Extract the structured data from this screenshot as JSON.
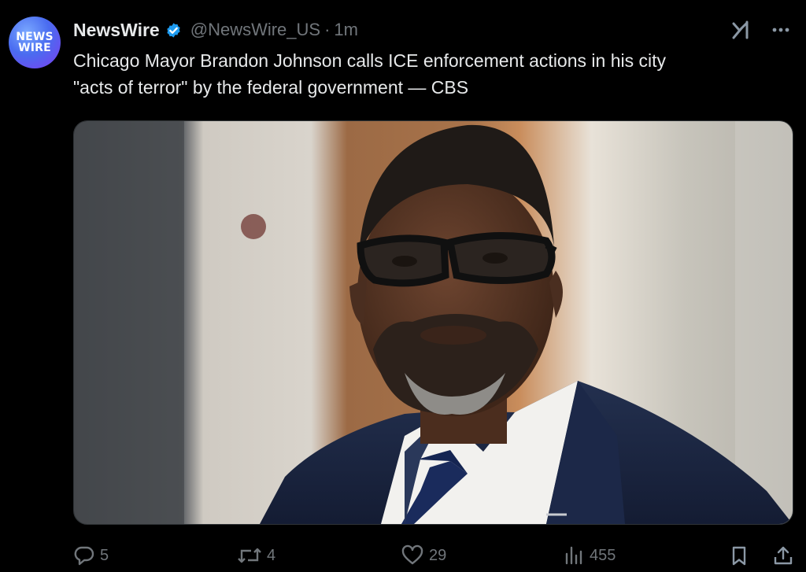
{
  "account": {
    "avatar_line1": "NEWS",
    "avatar_line2": "WIRE",
    "display_name": "NewsWire",
    "handle": "@NewsWire_US",
    "separator": "·",
    "time": "1m",
    "verified": true
  },
  "post": {
    "text_line1": "Chicago Mayor Brandon Johnson calls ICE enforcement actions in his city",
    "text_line2": "\"acts of terror\" by the federal government — CBS",
    "media_description": "Photo of a man wearing black-framed glasses, a navy suit, white shirt and navy tie"
  },
  "actions": {
    "replies": "5",
    "reposts": "4",
    "likes": "29",
    "views": "455"
  },
  "icons": {
    "verified": "verified-badge-icon",
    "grok": "grok-icon",
    "more": "more-icon",
    "reply": "reply-icon",
    "repost": "repost-icon",
    "like": "heart-icon",
    "views": "views-icon",
    "bookmark": "bookmark-icon",
    "share": "share-icon"
  },
  "colors": {
    "background": "#000000",
    "primary_text": "#e7e9ea",
    "secondary_text": "#71767b",
    "verified_blue": "#1d9bf0"
  }
}
